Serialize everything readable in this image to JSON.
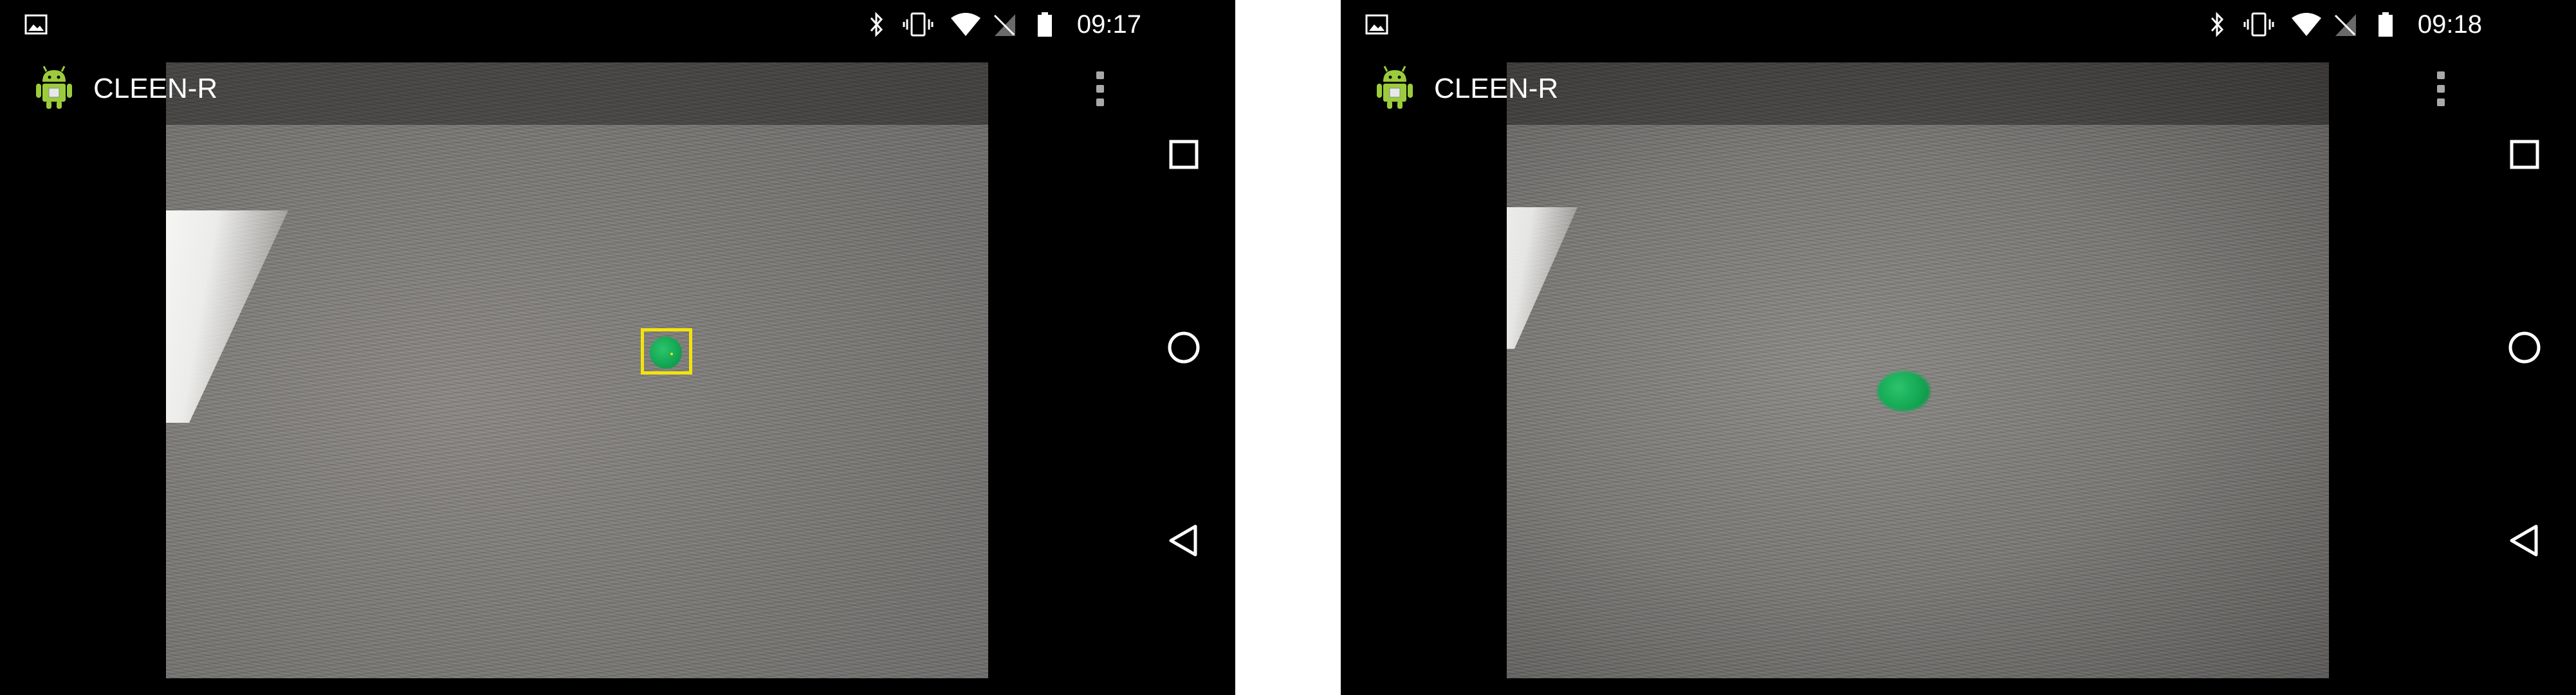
{
  "screens": [
    {
      "status_bar": {
        "notification_icon": "image-icon",
        "system_icons": [
          "bluetooth-icon",
          "vibrate-icon",
          "wifi-icon",
          "no-sim-icon",
          "battery-icon"
        ],
        "time": "09:17"
      },
      "action_bar": {
        "app_icon": "android-robot-icon",
        "title": "CLEEN-R",
        "overflow_icon": "more-vert-icon"
      },
      "camera_preview": {
        "object": "green-ball",
        "tracking_box_visible": true,
        "tracking_box_color": "#f2e40c"
      },
      "nav_bar": [
        "recents-icon",
        "home-icon",
        "back-icon"
      ]
    },
    {
      "status_bar": {
        "notification_icon": "image-icon",
        "system_icons": [
          "bluetooth-icon",
          "vibrate-icon",
          "wifi-icon",
          "no-sim-icon",
          "battery-icon"
        ],
        "time": "09:18"
      },
      "action_bar": {
        "app_icon": "android-robot-icon",
        "title": "CLEEN-R",
        "overflow_icon": "more-vert-icon"
      },
      "camera_preview": {
        "object": "green-ball",
        "tracking_box_visible": false
      },
      "nav_bar": [
        "recents-icon",
        "home-icon",
        "back-icon"
      ]
    }
  ],
  "colors": {
    "screen_background": "#000000",
    "status_text": "#ffffff",
    "ball_green": "#14a854",
    "tracking_box": "#f2e40c"
  }
}
